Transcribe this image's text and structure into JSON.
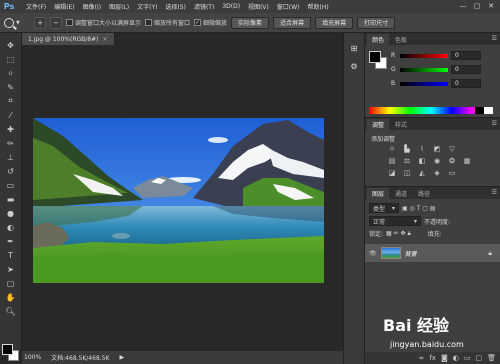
{
  "menubar": {
    "logo": "Ps",
    "items": [
      "文件(F)",
      "编辑(E)",
      "图像(I)",
      "图层(L)",
      "文字(Y)",
      "选择(S)",
      "滤镜(T)",
      "3D(D)",
      "视图(V)",
      "窗口(W)",
      "帮助(H)"
    ],
    "win_min": "—",
    "win_max": "▢",
    "win_close": "✕"
  },
  "options": {
    "resize_windows": "调整窗口大小以满屏显示",
    "zoom_all": "缩放所有窗口",
    "scrubby_zoom": "细微缩放",
    "scrubby_checked": "✓",
    "actual_pixels": "实际像素",
    "fit_screen": "适合屏幕",
    "fill_screen": "填充屏幕",
    "print_size": "打印尺寸",
    "zoom_in": "+",
    "zoom_out": "−"
  },
  "document": {
    "tab_title": "1.jpg @ 100%(RGB/8#)",
    "tab_close": "×"
  },
  "status": {
    "zoom": "100%",
    "doc_size": "文档:468.5K/468.5K"
  },
  "panels": {
    "color_tab": "颜色",
    "swatches_tab": "色板",
    "adjust_tab": "调整",
    "styles_tab": "样式",
    "add_adjustment": "添加调整",
    "layers_tab": "图层",
    "channels_tab": "通道",
    "paths_tab": "路径",
    "kind_label": "类型",
    "blend_mode": "正常",
    "opacity_label": "不透明度:",
    "lock_label": "锁定:",
    "fill_label": "填充:",
    "layer_name": "背景"
  },
  "sliders": [
    {
      "label": "R",
      "value": "0",
      "gradient": "linear-gradient(90deg,#000,#f00)"
    },
    {
      "label": "G",
      "value": "0",
      "gradient": "linear-gradient(90deg,#000,#0f0)"
    },
    {
      "label": "B",
      "value": "0",
      "gradient": "linear-gradient(90deg,#000,#00f)"
    }
  ],
  "watermark": {
    "text": "Bai 经验",
    "url": "jingyan.baidu.com"
  }
}
